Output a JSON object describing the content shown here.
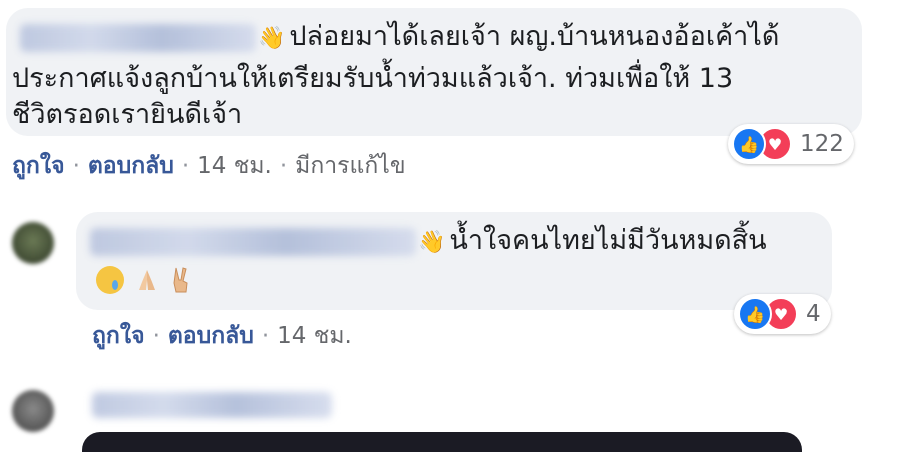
{
  "comments": [
    {
      "text_lines": [
        "ปล่อยมาได้เลยเจ้า ผญ.บ้านหนองอ้อเค้าได้",
        "ประกาศแจ้งลูกบ้านให้เตรียมรับน้ำท่วมแล้วเจ้า. ท่วมเพื่อให้ 13",
        "ชีวิตรอดเรายินดีเจ้า"
      ],
      "actions": {
        "like": "ถูกใจ",
        "reply": "ตอบกลับ",
        "time": "14 ชม.",
        "edited": "มีการแก้ไข"
      },
      "reaction_count": "122"
    },
    {
      "text_lines": [
        "น้ำใจคนไทยไม่มีวันหมดสิ้น"
      ],
      "emojis": [
        "crying-face-icon",
        "folded-hands-icon",
        "victory-hand-icon"
      ],
      "actions": {
        "like": "ถูกใจ",
        "reply": "ตอบกลับ",
        "time": "14 ชม."
      },
      "reaction_count": "4"
    }
  ],
  "colors": {
    "bubble": "#f0f2f5",
    "link": "#385898",
    "like": "#1877f2",
    "love": "#f33e58"
  }
}
